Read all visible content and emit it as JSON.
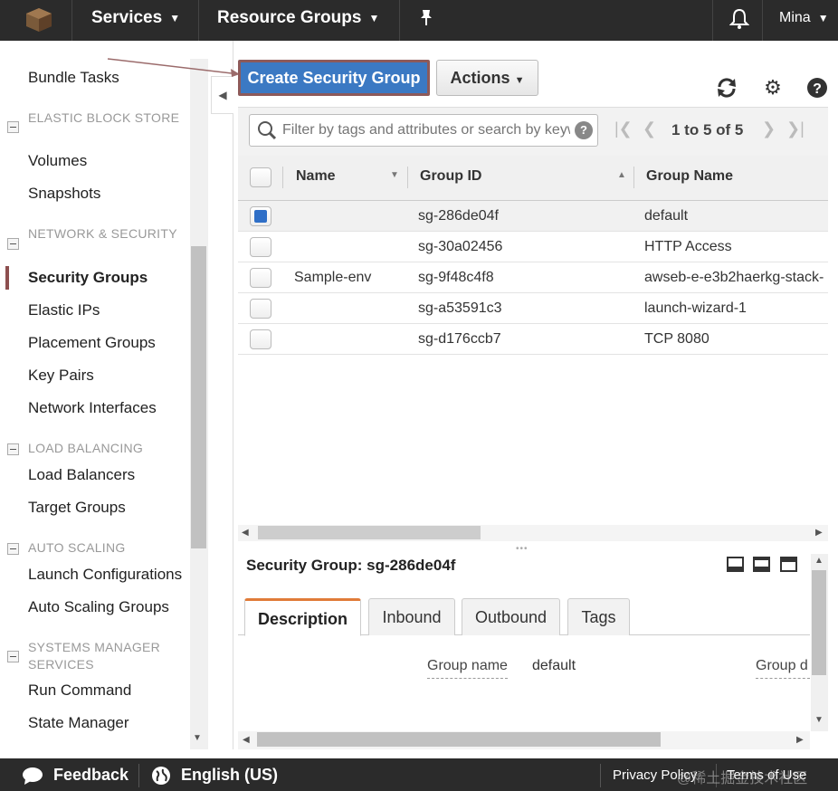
{
  "topnav": {
    "services": "Services",
    "resource_groups": "Resource Groups",
    "user": "Mina"
  },
  "sidebar": {
    "items_top": [
      "Bundle Tasks"
    ],
    "sections": [
      {
        "title": "ELASTIC BLOCK STORE",
        "items": [
          "Volumes",
          "Snapshots"
        ]
      },
      {
        "title": "NETWORK & SECURITY",
        "items": [
          "Security Groups",
          "Elastic IPs",
          "Placement Groups",
          "Key Pairs",
          "Network Interfaces"
        ]
      },
      {
        "title": "LOAD BALANCING",
        "items": [
          "Load Balancers",
          "Target Groups"
        ]
      },
      {
        "title": "AUTO SCALING",
        "items": [
          "Launch Configurations",
          "Auto Scaling Groups"
        ]
      },
      {
        "title": "SYSTEMS MANAGER SERVICES",
        "items": [
          "Run Command",
          "State Manager"
        ]
      }
    ],
    "active": "Security Groups"
  },
  "toolbar": {
    "create_label": "Create Security Group",
    "actions_label": "Actions"
  },
  "filter": {
    "placeholder": "Filter by tags and attributes or search by keyword",
    "pager": "1 to 5 of 5"
  },
  "table": {
    "columns": [
      "Name",
      "Group ID",
      "Group Name"
    ],
    "rows": [
      {
        "name": "",
        "group_id": "sg-286de04f",
        "group_name": "default",
        "selected": true
      },
      {
        "name": "",
        "group_id": "sg-30a02456",
        "group_name": "HTTP Access",
        "selected": false
      },
      {
        "name": "Sample-env",
        "group_id": "sg-9f48c4f8",
        "group_name": "awseb-e-e3b2haerkg-stack-",
        "selected": false
      },
      {
        "name": "",
        "group_id": "sg-a53591c3",
        "group_name": "launch-wizard-1",
        "selected": false
      },
      {
        "name": "",
        "group_id": "sg-d176ccb7",
        "group_name": "TCP 8080",
        "selected": false
      }
    ]
  },
  "detail": {
    "title": "Security Group: sg-286de04f",
    "tabs": [
      "Description",
      "Inbound",
      "Outbound",
      "Tags"
    ],
    "active_tab": "Description",
    "fields": {
      "group_name_label": "Group name",
      "group_name_value": "default",
      "group_desc_label": "Group d"
    }
  },
  "footer": {
    "feedback": "Feedback",
    "language": "English (US)",
    "privacy": "Privacy Policy",
    "terms": "Terms of Use",
    "watermark": "@稀土掘金技术社区"
  },
  "colors": {
    "nav_bg": "#2b2b2b",
    "primary_button": "#3b79c3",
    "active_tab_accent": "#e07b39",
    "active_bar": "#8d4f4f"
  }
}
